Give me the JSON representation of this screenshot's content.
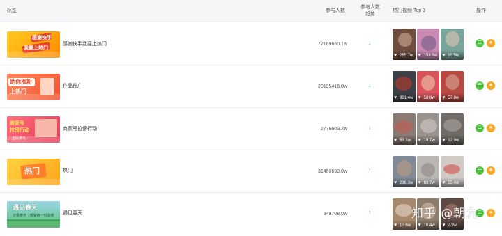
{
  "table": {
    "headers": {
      "title": "标签",
      "count": "参与人数",
      "trend": "参与人数趋势",
      "top3": "热门视频 Top 3",
      "ops": "操作"
    },
    "rows": [
      {
        "thumb_text": "感谢快手\n我要上热门",
        "title": "感谢快手我要上热门",
        "count": "72189650.1w",
        "trend": "down",
        "trend_glyph": "↓",
        "videos": [
          {
            "likes": "265.7w"
          },
          {
            "likes": "153.9w"
          },
          {
            "likes": "95.5w"
          }
        ]
      },
      {
        "thumb_text": "助你涨粉\n上热门",
        "title": "作品推广",
        "count": "20195416.0w",
        "trend": "down",
        "trend_glyph": "↓",
        "videos": [
          {
            "likes": "381.4w"
          },
          {
            "likes": "58.8w"
          },
          {
            "likes": "57.0w"
          }
        ]
      },
      {
        "thumb_text": "商家号\n拉傍行动",
        "thumb_sub": "· 全民参与 ·",
        "title": "商家号拉傍行动",
        "count": "2776603.2w",
        "trend": "down",
        "trend_glyph": "↓",
        "videos": [
          {
            "likes": "53.2w"
          },
          {
            "likes": "19.7w"
          },
          {
            "likes": "12.9w"
          }
        ]
      },
      {
        "thumb_text": "热门",
        "title": "热门",
        "count": "31450690.0w",
        "trend": "up",
        "trend_glyph": "↑",
        "videos": [
          {
            "likes": "236.3w"
          },
          {
            "likes": "69.7w"
          },
          {
            "likes": "55.4w"
          }
        ]
      },
      {
        "thumb_text": "遇见春天",
        "thumb_sub": "记录春天 · 感受每一刻温暖",
        "title": "遇见春天",
        "count": "349708.0w",
        "trend": "up",
        "trend_glyph": "↑",
        "videos": [
          {
            "likes": "17.6w"
          },
          {
            "likes": "10.4w"
          },
          {
            "likes": "7.9w"
          }
        ]
      }
    ]
  },
  "watermark": "知乎 @朝九",
  "colors": {
    "down_arrow": "#2bbd62",
    "up_arrow": "#e84646",
    "green_button": "#4cc33f",
    "orange_button": "#f6a623",
    "header_bg": "#f5f6f8"
  },
  "icons": {
    "row_action_1": "list-icon",
    "row_action_2": "star-icon",
    "video_like": "heart-icon"
  }
}
